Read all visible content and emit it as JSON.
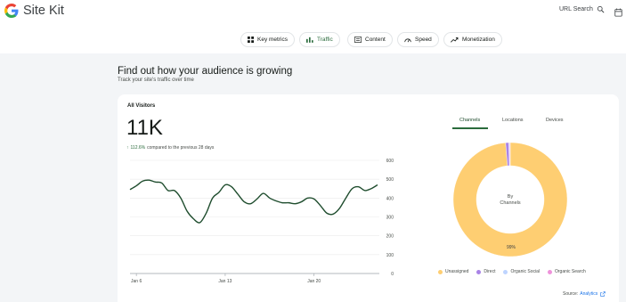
{
  "header": {
    "brand": "Site Kit",
    "url_search_label": "URL Search"
  },
  "nav": {
    "chips": [
      {
        "label": "Key metrics",
        "icon": "grid-icon"
      },
      {
        "label": "Traffic",
        "icon": "bar-chart-icon"
      },
      {
        "label": "Content",
        "icon": "content-icon"
      },
      {
        "label": "Speed",
        "icon": "speedometer-icon"
      },
      {
        "label": "Monetization",
        "icon": "trend-icon"
      }
    ],
    "active": "Traffic"
  },
  "hero": {
    "title": "Find out how your audience is growing",
    "subtitle": "Track your site's traffic over time"
  },
  "card": {
    "title": "All Visitors",
    "value": "11K",
    "delta": "112.6%",
    "delta_suffix": "compared to the previous 28 days",
    "tabs": [
      "Channels",
      "Locations",
      "Devices"
    ],
    "active_tab": "Channels",
    "donut_center": [
      "By",
      "Channels"
    ],
    "donut_pct_label": "99%",
    "legend": [
      {
        "label": "Unassigned",
        "color": "#fece72"
      },
      {
        "label": "Direct",
        "color": "#a983e6"
      },
      {
        "label": "Organic Social",
        "color": "#bed4ff"
      },
      {
        "label": "Organic Search",
        "color": "#ee92da"
      }
    ],
    "source_label": "Source:",
    "source_link": "Analytics"
  },
  "chart_data": [
    {
      "type": "line",
      "title": "",
      "xlabel": "",
      "ylabel": "",
      "ylim": [
        0,
        600
      ],
      "yticks": [
        0,
        100,
        200,
        300,
        400,
        500,
        600
      ],
      "xtick_labels": [
        {
          "x": 1,
          "label": "Jan 6"
        },
        {
          "x": 15,
          "label": "Jan 13"
        },
        {
          "x": 29,
          "label": "Jan 20"
        }
      ],
      "color": "#1f4d2e",
      "grid": true,
      "series": [
        {
          "x": [
            0,
            1,
            2,
            3,
            4,
            5,
            6,
            7,
            8,
            9,
            10,
            11,
            12,
            13,
            14,
            15,
            16,
            17,
            18,
            19,
            20,
            21,
            22,
            23,
            24,
            25,
            26,
            27,
            28,
            29,
            30,
            31,
            32,
            33,
            34,
            35,
            36,
            37,
            38,
            39
          ],
          "values": [
            445,
            465,
            490,
            495,
            485,
            480,
            440,
            440,
            400,
            330,
            290,
            270,
            320,
            400,
            430,
            470,
            460,
            420,
            380,
            370,
            395,
            425,
            400,
            385,
            375,
            375,
            370,
            380,
            400,
            395,
            360,
            320,
            315,
            345,
            400,
            450,
            460,
            440,
            450,
            470
          ]
        }
      ]
    },
    {
      "type": "pie",
      "categories": [
        "Unassigned",
        "Direct",
        "Organic Social",
        "Organic Search"
      ],
      "values": [
        98.7,
        0.9,
        0.2,
        0.2
      ],
      "colors": [
        "#fece72",
        "#a983e6",
        "#bed4ff",
        "#ee92da"
      ]
    }
  ]
}
